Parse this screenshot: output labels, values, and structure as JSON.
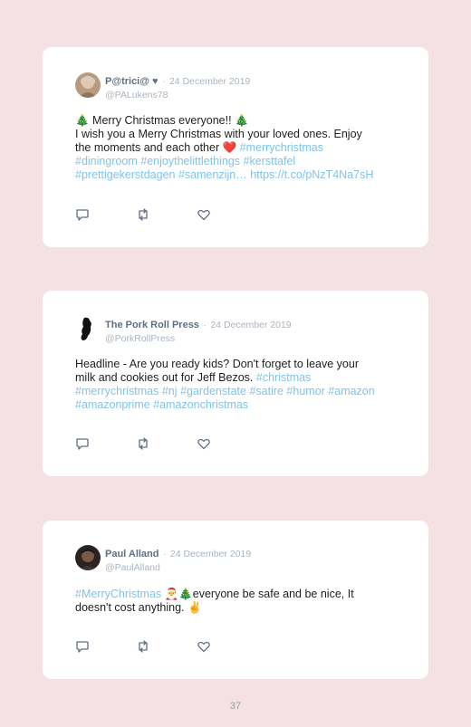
{
  "tweets": [
    {
      "name": "P@trici@ ♥",
      "dot": "·",
      "date": "24 December 2019",
      "handle": "@PALukens78",
      "line1": "🎄 Merry Christmas everyone!! 🎄",
      "line2a": "I wish you a Merry Christmas with your loved ones. Enjoy",
      "line2b": "the moments and each other ❤️ ",
      "hashtags1": "#merrychristmas",
      "hashtags2": "#diningroom #enjoythelittlethings #kersttafel",
      "hashtags3": "#prettigekerstdagen #samenzijn…",
      "link": "https://t.co/pNzT4Na7sH"
    },
    {
      "name": "The Pork Roll Press",
      "dot": "·",
      "date": "24 December 2019",
      "handle": "@PorkRollPress",
      "line1": "Headline - Are you ready kids? Don't forget to leave your",
      "line2": "milk and cookies out for Jeff Bezos. ",
      "hashtags1": "#christmas",
      "hashtags2": "#merrychristmas #nj #gardenstate #satire #humor #amazon",
      "hashtags3": "#amazonprime #amazonchristmas"
    },
    {
      "name": "Paul Alland",
      "dot": "·",
      "date": "24 December 2019",
      "handle": "@PaulAlland",
      "hashtag": "#MerryChristmas",
      "emoji": " 🎅🎄",
      "text1": "everyone be safe and be nice, It",
      "text2": "doesn't cost anything. ✌️"
    }
  ],
  "icons": [
    "reply-icon",
    "retweet-icon",
    "like-icon"
  ],
  "colors": {
    "background": "#f4e1e3",
    "hashtag": "#7fc3ea",
    "name": "#5f6f84",
    "muted": "#a9b4c1"
  },
  "page_number": "37"
}
